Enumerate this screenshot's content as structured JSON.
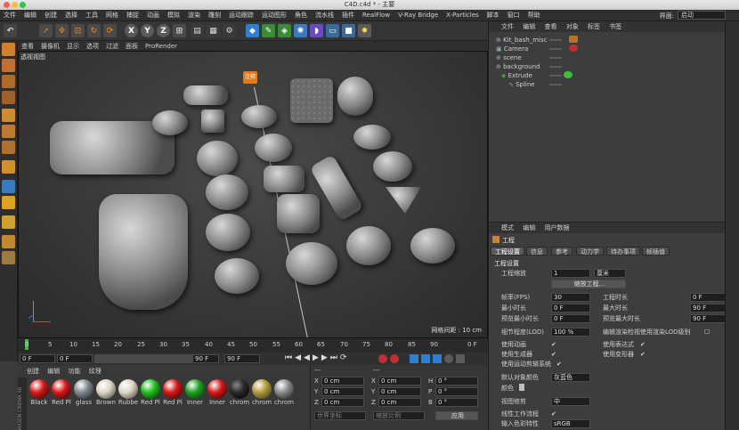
{
  "window": {
    "title": "C4D.c4d * - 主要"
  },
  "menubar": {
    "items": [
      "文件",
      "编辑",
      "创建",
      "选择",
      "工具",
      "网格",
      "捕捉",
      "动画",
      "模拟",
      "渲染",
      "雕刻",
      "运动跟踪",
      "运动图形",
      "角色",
      "流水线",
      "插件",
      "RealFlow",
      "V-Ray Bridge",
      "X-Particles",
      "脚本",
      "窗口",
      "帮助"
    ],
    "layout_label": "界面:",
    "layout_value": "启动"
  },
  "viewport": {
    "menu": [
      "查看",
      "摄像机",
      "显示",
      "选项",
      "过滤",
      "面板",
      "ProRender"
    ],
    "title": "透视视图",
    "grid_spacing": "网格间距 : 10 cm",
    "annotation_label": "注释"
  },
  "timeline": {
    "ticks": [
      "0",
      "5",
      "10",
      "15",
      "20",
      "25",
      "30",
      "35",
      "40",
      "45",
      "50",
      "55",
      "60",
      "65",
      "70",
      "75",
      "80",
      "85",
      "90"
    ],
    "frame_end_marker": "0 F",
    "start_field": "0 F",
    "current_field": "0 F",
    "end_field": "90 F",
    "max_field": "90 F"
  },
  "materials": {
    "menu": [
      "创建",
      "编辑",
      "功能",
      "纹理"
    ],
    "items": [
      {
        "name": "Black",
        "color": "#d41a1a"
      },
      {
        "name": "Red Pl",
        "color": "#d41a1a"
      },
      {
        "name": "glass",
        "color": "#7e8a8e"
      },
      {
        "name": "Brown",
        "color": "#ddd6c4"
      },
      {
        "name": "Rubbe",
        "color": "#ddd6c4"
      },
      {
        "name": "Red Pl",
        "color": "#20c020"
      },
      {
        "name": "Red Pl",
        "color": "#d41a1a"
      },
      {
        "name": "Inner",
        "color": "#20a020"
      },
      {
        "name": "Inner",
        "color": "#d41a1a"
      },
      {
        "name": "chrom",
        "color": "#2a2a2a"
      },
      {
        "name": "chrom",
        "color": "#b59a3a"
      },
      {
        "name": "chrom",
        "color": "#8a8a8a"
      }
    ],
    "brand": "MAXON CINEMA 4D"
  },
  "coordinates": {
    "header_left": "---",
    "header_right": "---",
    "rows": [
      {
        "a_label": "X",
        "a_value": "0 cm",
        "b_label": "X",
        "b_value": "0 cm",
        "c_label": "H",
        "c_value": "0 °"
      },
      {
        "a_label": "Y",
        "a_value": "0 cm",
        "b_label": "Y",
        "b_value": "0 cm",
        "c_label": "P",
        "c_value": "0 °"
      },
      {
        "a_label": "Z",
        "a_value": "0 cm",
        "b_label": "Z",
        "b_value": "0 cm",
        "c_label": "B",
        "c_value": "0 °"
      }
    ],
    "space_select": "世界坐标",
    "scale_select": "缩放比例",
    "apply_button": "应用"
  },
  "objects": {
    "menu": [
      "文件",
      "编辑",
      "查看",
      "对象",
      "标签",
      "书签"
    ],
    "rows": [
      {
        "name": "Kit_bash_misc",
        "indent": 0
      },
      {
        "name": "Camera",
        "indent": 0
      },
      {
        "name": "scene",
        "indent": 0
      },
      {
        "name": "background",
        "indent": 0
      },
      {
        "name": "Extrude",
        "indent": 1
      },
      {
        "name": "Spline",
        "indent": 2
      }
    ]
  },
  "attributes": {
    "menu": [
      "模式",
      "编辑",
      "用户数据"
    ],
    "section_title": "工程",
    "tabs": [
      "工程设置",
      "信息",
      "参考",
      "动力学",
      "待办事项",
      "帧插值"
    ],
    "group_title": "工程设置",
    "scale_label": "工程缩放",
    "scale_value": "1",
    "scale_unit": "厘米",
    "scale_button": "缩放工程...",
    "fps_label": "帧率(FPS)",
    "fps_value": "30",
    "project_time_label": "工程时长",
    "project_time_value": "0 F",
    "min_time_label": "最小时长",
    "min_time_value": "0 F",
    "max_time_label": "最大时长",
    "max_time_value": "90 F",
    "preview_min_label": "预览最小时长",
    "preview_min_value": "0 F",
    "preview_max_label": "预览最大时长",
    "preview_max_value": "90 F",
    "lod_label": "细节程度(LOD)",
    "lod_value": "100 %",
    "lod_render_label": "编辑渲染检视使用渲染LOD级别",
    "use_animation_label": "使用动画",
    "use_expressions_label": "使用表达式",
    "use_generators_label": "使用生成器",
    "use_deformers_label": "使用变形器",
    "use_motion_label": "使用运动剪辑系统",
    "default_color_label": "默认对象颜色",
    "default_color_value": "灰蓝色",
    "color_label": "颜色",
    "view_clip_label": "视图修剪",
    "view_clip_value": "中",
    "linear_label": "线性工作流程",
    "input_color_label": "输入色彩特性",
    "input_color_value": "sRGB"
  },
  "colors": {
    "accent_orange": "#e07a1a",
    "selected_green": "#3fbf3f",
    "panel_bg": "#3d3d3d"
  }
}
